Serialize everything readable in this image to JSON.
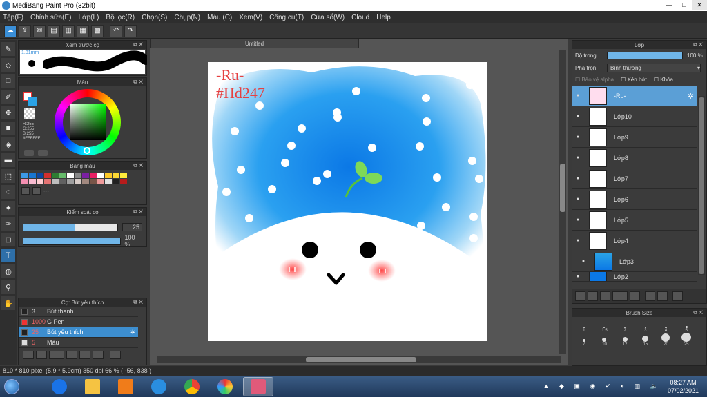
{
  "window": {
    "title": "MediBang Paint Pro (32bit)",
    "controls": [
      "—",
      "□",
      "✕"
    ]
  },
  "menu": [
    "Tệp(F)",
    "Chỉnh sửa(E)",
    "Lớp(L)",
    "Bộ lọc(R)",
    "Chọn(S)",
    "Chụp(N)",
    "Màu (C)",
    "Xem(V)",
    "Công cụ(T)",
    "Cửa sổ(W)",
    "Cloud",
    "Help"
  ],
  "toolbar_icons": [
    "cloud-icon",
    "export-icon",
    "chat-icon",
    "doc-icon",
    "page-icon",
    "grid-icon",
    "tiles-icon",
    "undo-icon",
    "redo-icon"
  ],
  "left_tools": [
    "brush-icon",
    "eraser-icon",
    "rect-icon",
    "pen-icon",
    "move-icon",
    "fill-rect-icon",
    "bucket-icon",
    "gradient-icon",
    "select-rect-icon",
    "lasso-icon",
    "magic-wand-icon",
    "select-pen-icon",
    "select-eraser-icon",
    "text-icon",
    "lasso-fill-icon",
    "eyedropper-icon",
    "hand-icon",
    "zoom-icon"
  ],
  "preview": {
    "title": "Xem trước cọ",
    "size": "1.81mm"
  },
  "color": {
    "title": "Màu",
    "r": "R:255",
    "g": "G:255",
    "b": "B:255",
    "hex": "#FFFFFF"
  },
  "palette": {
    "title": "Bảng màu",
    "dash": "---",
    "colors": [
      "#3d9ae8",
      "#1976d2",
      "#0d47a1",
      "#d32f2f",
      "#2e7d32",
      "#66bb6a",
      "#ffffff",
      "#888888",
      "#7b1fa2",
      "#e91e63",
      "#ffffff",
      "#ffca28",
      "#fdd835",
      "#ffeb3b",
      "#f48fb1",
      "#f8bbd0",
      "#ffcdd2",
      "#e57373",
      "#bdbdbd",
      "#616161",
      "#9e9e9e",
      "#d7ccc8",
      "#a1887f",
      "#795548",
      "#ef9a9a",
      "#e0e0e0",
      "#212121",
      "#b71c1c"
    ]
  },
  "brush_control": {
    "title": "Kiểm soát cọ",
    "size": "25",
    "opacity": "100 %",
    "size_fraction": 0.55,
    "opacity_fraction": 1.0
  },
  "brushes": {
    "title": "Cọ: Bút yêu thích",
    "rows": [
      {
        "num": "3",
        "name": "Bút thanh"
      },
      {
        "num": "1000",
        "name": "G Pen"
      },
      {
        "num": "25",
        "name": "Bút yêu thích"
      },
      {
        "num": "5",
        "name": "Màu"
      }
    ]
  },
  "document": {
    "tab": "Untitled"
  },
  "canvas_text": {
    "line1": "-Ru-",
    "line2": "#Hd247"
  },
  "layers": {
    "title": "Lớp",
    "opacity_label": "Độ trong",
    "opacity_value": "100 %",
    "blend_label": "Pha trộn",
    "blend_value": "Bình thường",
    "protect_alpha": "Bảo vệ alpha",
    "clip": "Xén bớt",
    "lock": "Khóa",
    "rows": [
      "-Ru-",
      "Lớp10",
      "Lớp9",
      "Lớp8",
      "Lớp7",
      "Lớp6",
      "Lớp5",
      "Lớp4",
      "Lớp3",
      "Lớp2"
    ]
  },
  "brush_size": {
    "title": "Brush Size",
    "sizes": [
      "1",
      "1.5",
      "2",
      "3",
      "4",
      "5",
      "7",
      "10",
      "12",
      "15",
      "20",
      "25"
    ]
  },
  "status": {
    "text": "810 * 810 pixel  (5.9 * 5.9cm)  350 dpi  66 %  ( -56, 838 )"
  },
  "taskbar": {
    "apps": [
      "zalo-icon",
      "explorer-icon",
      "media-icon",
      "ie-icon",
      "chrome-icon",
      "photos-icon",
      "medibang-icon"
    ],
    "time": "08:27 AM",
    "date": "07/02/2021"
  }
}
